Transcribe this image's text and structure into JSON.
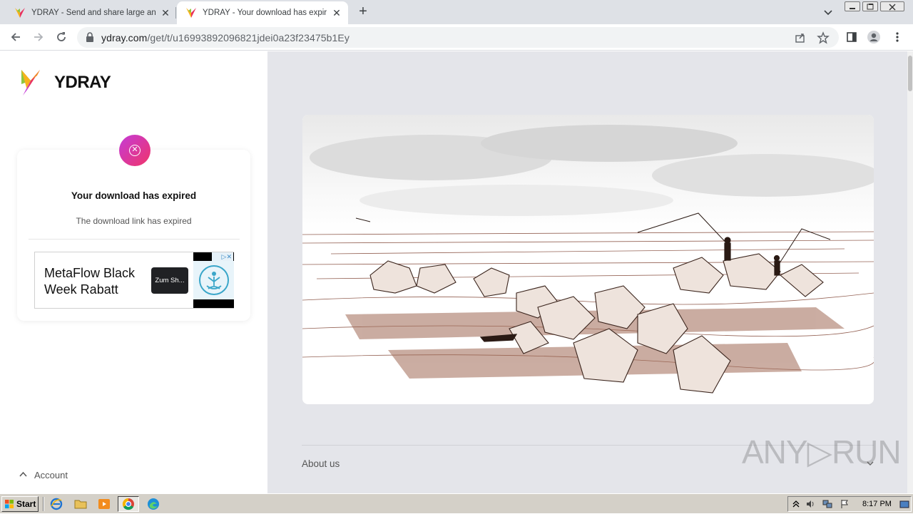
{
  "browser": {
    "tabs": [
      {
        "title": "YDRAY - Send and share large and b",
        "active": false
      },
      {
        "title": "YDRAY - Your download has expired",
        "active": true
      }
    ],
    "new_tab_symbol": "+",
    "tab_close_symbol": "✕",
    "address": {
      "host": "ydray.com",
      "path": "/get/t/u16993892096821jdei0a23f23475b1Ey"
    },
    "nav": {
      "back_icon": "back-arrow-icon",
      "forward_icon": "forward-arrow-icon",
      "reload_icon": "reload-icon"
    }
  },
  "page": {
    "brand": "YDRAY",
    "error_symbol": "✕",
    "status_title": "Your download has expired",
    "status_subtitle": "The download link has expired",
    "ad": {
      "headline": "MetaFlow Black Week Rabatt",
      "cta": "Zum Sh...",
      "adchoices": "▷✕"
    },
    "account_label": "Account",
    "about_label": "About us",
    "watermark": "ANY▷RUN"
  },
  "colors": {
    "accent_gradient_start": "#c43bd7",
    "accent_gradient_end": "#f0356a",
    "right_background": "#e4e5ea"
  },
  "taskbar": {
    "start_label": "Start",
    "clock": "8:17 PM",
    "pinned": [
      "ie-icon",
      "folder-icon",
      "media-player-icon",
      "chrome-icon",
      "edge-icon"
    ]
  }
}
